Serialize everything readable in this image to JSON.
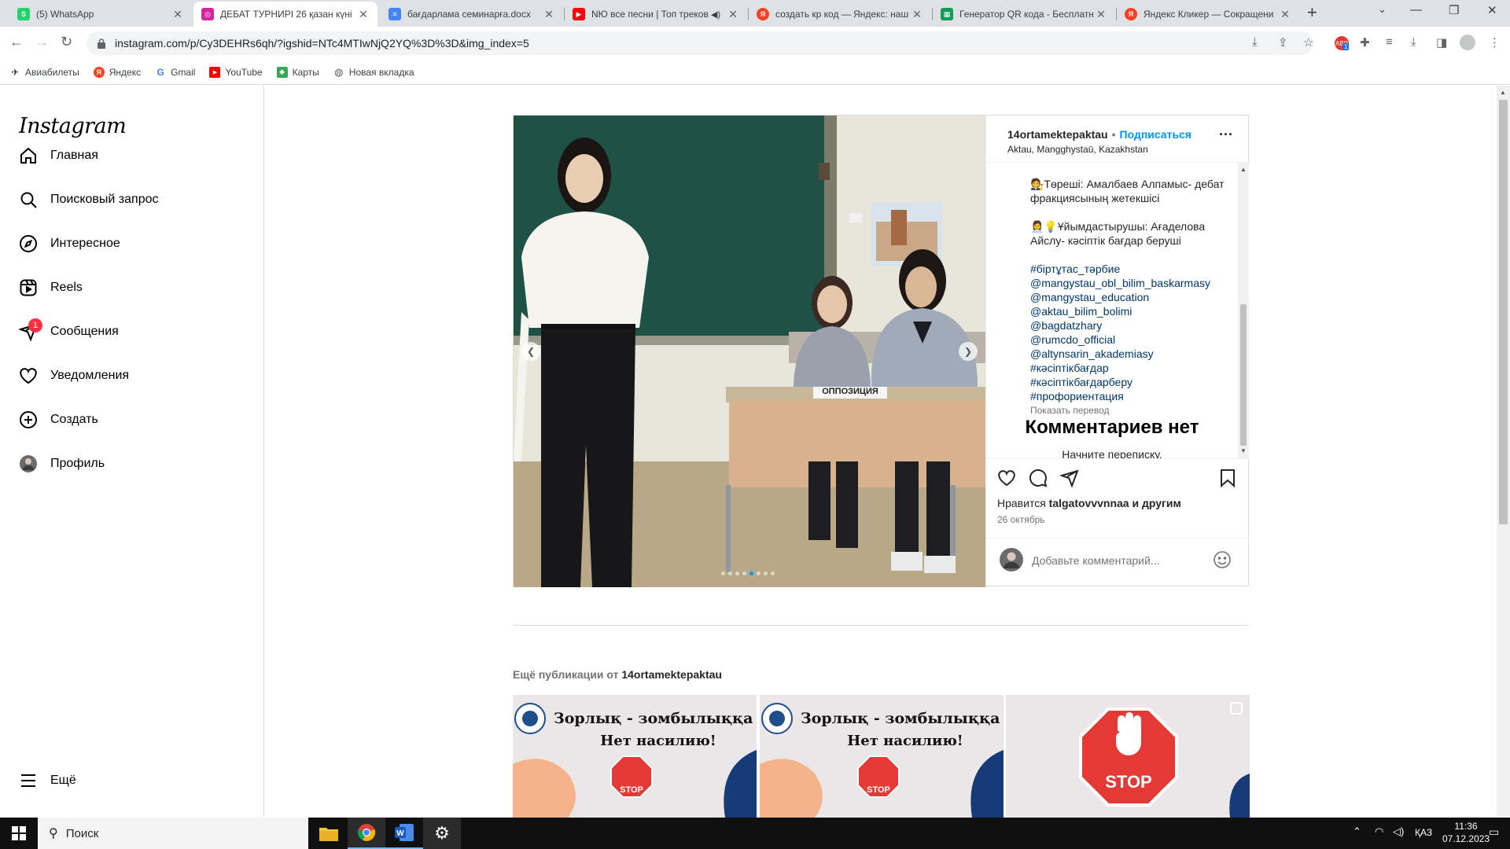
{
  "browser": {
    "tabs": [
      {
        "title": "(5) WhatsApp",
        "color": "#25d366",
        "glyph": "S"
      },
      {
        "title": "ДЕБАТ ТУРНИРІ 26 қазан күні",
        "color": "#d6249f",
        "glyph": "◎"
      },
      {
        "title": "бағдарлама семинарға.docx",
        "color": "#4285f4",
        "glyph": "≡"
      },
      {
        "title": "NЮ все песни | Топ треков",
        "color": "#ff0000",
        "glyph": "▶"
      },
      {
        "title": "создать кр код — Яндекс: наш",
        "color": "#fc3f1d",
        "glyph": "Я"
      },
      {
        "title": "Генератор QR кода - Бесплатн",
        "color": "#0f9d58",
        "glyph": "▦"
      },
      {
        "title": "Яндекс Кликер — Сокращени",
        "color": "#fc3f1d",
        "glyph": "Я"
      }
    ],
    "url": "instagram.com/p/Cy3DEHRs6qh/?igshid=NTc4MTIwNjQ2YQ%3D%3D&img_index=5",
    "bookmarks": [
      "Авиабилеты",
      "Яндекс",
      "Gmail",
      "YouTube",
      "Карты",
      "Новая вкладка"
    ],
    "ext_badge": "1"
  },
  "sidebar": {
    "logo": "Instagram",
    "items": [
      {
        "label": "Главная",
        "icon": "home-icon"
      },
      {
        "label": "Поисковый запрос",
        "icon": "search-icon"
      },
      {
        "label": "Интересное",
        "icon": "compass-icon"
      },
      {
        "label": "Reels",
        "icon": "reels-icon"
      },
      {
        "label": "Сообщения",
        "icon": "messenger-icon",
        "badge": "1"
      },
      {
        "label": "Уведомления",
        "icon": "heart-icon"
      },
      {
        "label": "Создать",
        "icon": "plus-square-icon"
      },
      {
        "label": "Профиль",
        "icon": "avatar"
      }
    ],
    "more": "Ещё"
  },
  "post": {
    "username": "14ortamektepaktau",
    "sep": "•",
    "follow": "Подписаться",
    "location": "Aktau, Mangghystaū, Kazakhstan",
    "caption_lines": [
      "🧑‍⚖️Төреші: Амалбаев Алпамыс- дебат фракциясының жетекшісі",
      "👩‍💼💡Ұйымдастырушы: Ағаделова Айслу- кәсіптік бағдар беруші"
    ],
    "hashtags": [
      "#біртұтас_тәрбие",
      "@mangystau_obl_bilim_baskarmasy",
      "@mangystau_education",
      "@aktau_bilim_bolimi",
      "@bagdatzhary",
      "@rumcdo_official",
      "@altynsarin_akademiasy",
      "#кәсіптікбағдар",
      "#кәсіптікбағдарберу",
      "#профориентация"
    ],
    "show_translation": "Показать перевод",
    "no_comments": "Комментариев нет",
    "start_chat": "Начните переписку.",
    "likes_prefix": "Нравится",
    "likes_user": "talgatovvvnnaa",
    "likes_suffix": "и другим",
    "date": "26 октябрь",
    "comment_placeholder": "Добавьте комментарий...",
    "sign_text": "ОППОЗИЦИЯ",
    "carousel_total": 8,
    "carousel_active": 5
  },
  "more_posts": {
    "prefix": "Ещё публикации от",
    "user": "14ortamektepaktau",
    "thumbs": [
      {
        "line1": "Зорлық - зомбылыққа жо",
        "line2": "Нет насилию!",
        "stop": "STOP"
      },
      {
        "line1": "Зорлық - зомбылыққа жо",
        "line2": "Нет насилию!",
        "stop": "STOP"
      },
      {
        "line1": "",
        "line2": "",
        "stop": "STOP"
      }
    ]
  },
  "taskbar": {
    "search": "Поиск",
    "lang": "ҚАЗ",
    "time": "11:36",
    "date": "07.12.2023"
  }
}
